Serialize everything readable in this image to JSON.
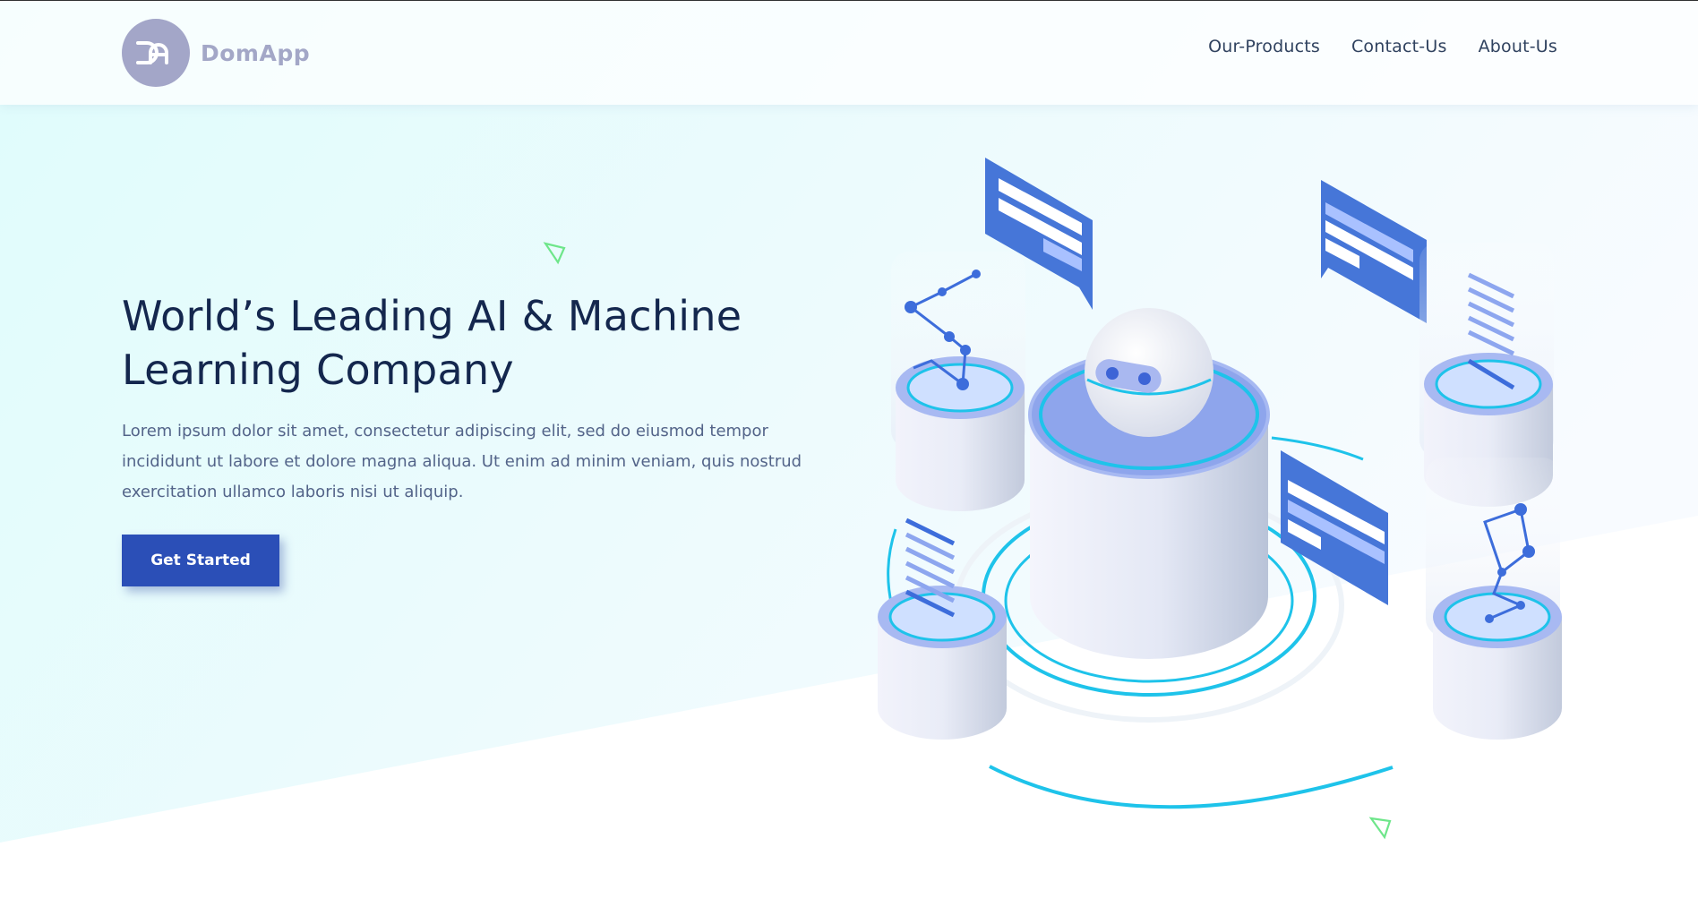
{
  "brand": {
    "name": "DomApp",
    "logo_icon": "da-monogram-icon",
    "logo_color": "#a3a6c8"
  },
  "nav": {
    "items": [
      {
        "label": "Our-Products"
      },
      {
        "label": "Contact-Us"
      },
      {
        "label": "About-Us"
      }
    ]
  },
  "hero": {
    "title": "World’s Leading AI & Machine Learning Company",
    "description": "Lorem ipsum dolor sit amet, consectetur adipiscing elit, sed do eiusmod tempor incididunt ut labore et dolore magna aliqua. Ut enim ad minim veniam, quis nostrud exercitation ullamco laboris nisi ut aliquip.",
    "cta_label": "Get Started",
    "illustration": "ai-robot-isometric-illustration"
  },
  "colors": {
    "primary": "#2b4fb7",
    "heading": "#14274e",
    "body_text": "#536489",
    "hero_background": "#e2fcfc",
    "accent_cyan": "#1ec3ea",
    "accent_green": "#6ee68a"
  }
}
